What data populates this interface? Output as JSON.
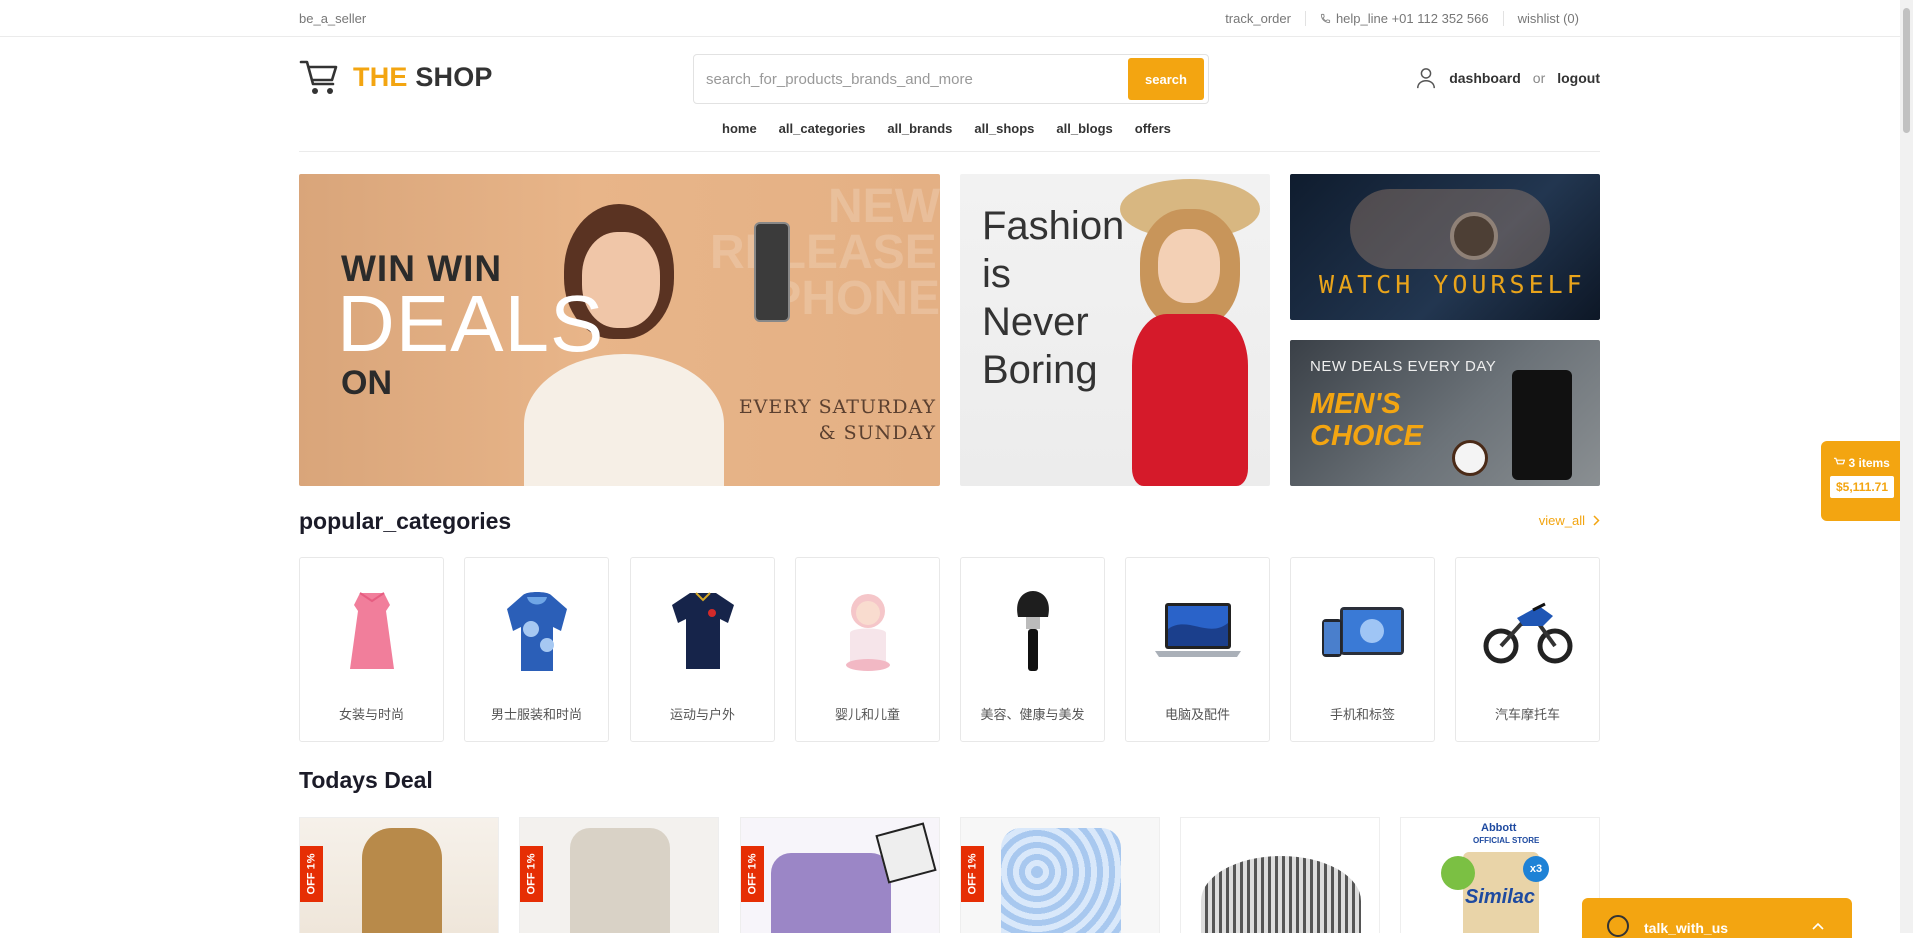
{
  "topbar": {
    "be_a_seller": "be_a_seller",
    "track_order": "track_order",
    "help_line": "help_line +01 112 352 566",
    "wishlist": "wishlist (0)"
  },
  "logo": {
    "the": "THE",
    "shop": "SHOP"
  },
  "search": {
    "placeholder": "search_for_products_brands_and_more",
    "button": "search"
  },
  "account": {
    "dashboard": "dashboard",
    "or": "or",
    "logout": "logout"
  },
  "nav": [
    "home",
    "all_categories",
    "all_brands",
    "all_shops",
    "all_blogs",
    "offers"
  ],
  "banners": {
    "b1": {
      "line1": "WIN WIN",
      "line2": "DEALS",
      "line3": "ON",
      "bg_text": "NEW RELEASED PHONE",
      "days1": "EVERY SATURDAY",
      "days2": "& SUNDAY"
    },
    "b2": {
      "line1": "Fashion",
      "line2": "is",
      "line3": "Never",
      "line4": "Boring"
    },
    "b3": {
      "text": "WATCH YOURSELF"
    },
    "b4": {
      "top": "NEW DEALS EVERY DAY",
      "line1": "MEN'S",
      "line2": "CHOICE"
    }
  },
  "popular": {
    "title": "popular_categories",
    "view_all": "view_all",
    "categories": [
      {
        "label": "女装与时尚",
        "icon": "dress-icon"
      },
      {
        "label": "男士服装和时尚",
        "icon": "hoodie-icon"
      },
      {
        "label": "运动与户外",
        "icon": "jersey-icon"
      },
      {
        "label": "婴儿和儿童",
        "icon": "doll-icon"
      },
      {
        "label": "美容、健康与美发",
        "icon": "makeup-brush-icon"
      },
      {
        "label": "电脑及配件",
        "icon": "laptop-icon"
      },
      {
        "label": "手机和标签",
        "icon": "tablet-phone-icon"
      },
      {
        "label": "汽车摩托车",
        "icon": "motorcycle-icon"
      }
    ]
  },
  "todays_deal": {
    "title": "Todays Deal",
    "off_label": "OFF 1%",
    "abbott": "Abbott",
    "official_store": "OFFICIAL STORE",
    "similac": "Similac",
    "x3": "x3"
  },
  "cart_widget": {
    "items": "3 items",
    "total": "$5,111.71"
  },
  "chat": {
    "label": "talk_with_us"
  },
  "colors": {
    "accent": "#f3a511",
    "discount": "#e62e04"
  }
}
